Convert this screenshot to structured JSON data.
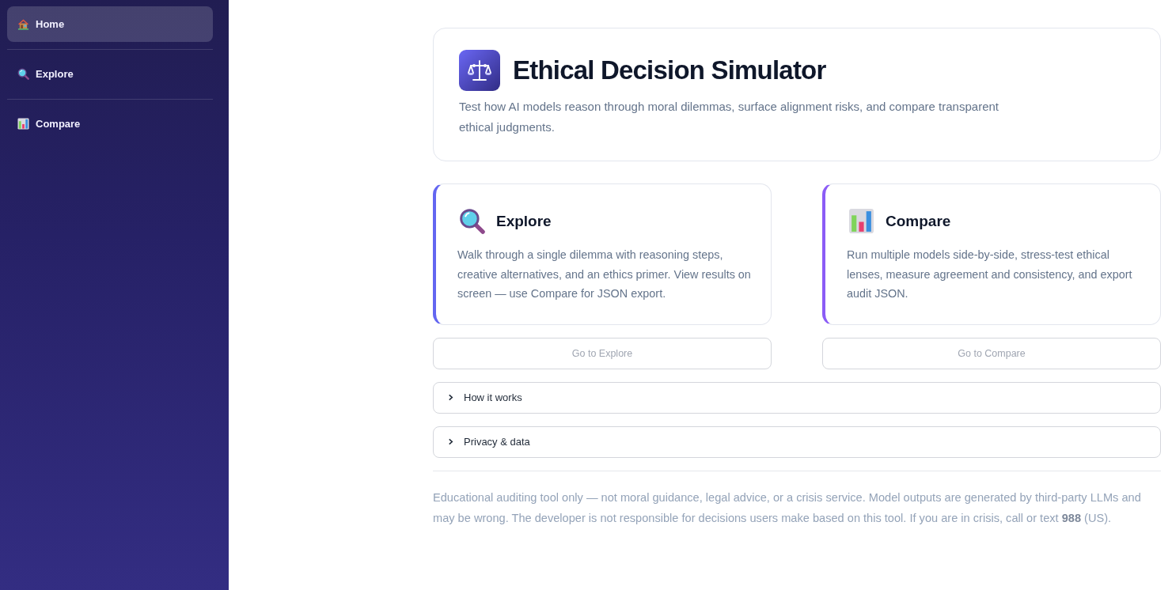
{
  "sidebar": {
    "items": [
      {
        "label": "Home",
        "selected": true
      },
      {
        "label": "Explore",
        "selected": false
      },
      {
        "label": "Compare",
        "selected": false
      }
    ]
  },
  "hero": {
    "title": "Ethical Decision Simulator",
    "subtitle": "Test how AI models reason through moral dilemmas, surface alignment risks, and compare transparent ethical judgments."
  },
  "cards": [
    {
      "title": "Explore",
      "description": "Walk through a single dilemma with reasoning steps, creative alternatives, and an ethics primer. View results on screen — use Compare for JSON export.",
      "color": "#6366f1",
      "button": {
        "label": "Go to Explore",
        "disabled": true
      }
    },
    {
      "title": "Compare",
      "description": "Run multiple models side-by-side, stress-test ethical lenses, measure agreement and consistency, and export audit JSON.",
      "color": "#8b5cf6",
      "button": {
        "label": "Go to Compare",
        "disabled": true
      }
    }
  ],
  "sections": [
    {
      "label": "How it works",
      "expanded": false
    },
    {
      "label": "Privacy & data",
      "expanded": false
    }
  ],
  "disclaimer": "Educational auditing tool only — not moral guidance, legal advice, or a crisis service. Model outputs are generated by third-party LLMs and may be wrong. The developer is not responsible for decisions users make based on this tool. If you are in crisis, call or text **988** (US)."
}
